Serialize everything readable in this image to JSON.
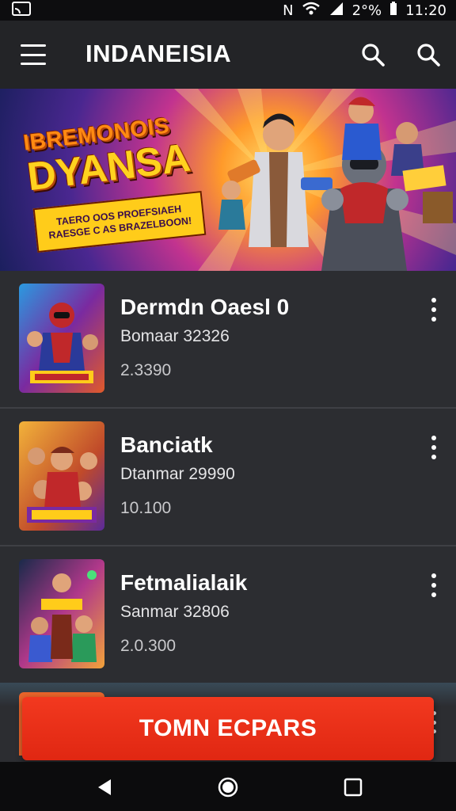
{
  "status_bar": {
    "left_icon": "cast-icon",
    "signal_label": "N",
    "battery_text": "2°%",
    "time": "11:20"
  },
  "app_bar": {
    "title": "INDANEISIA"
  },
  "banner": {
    "title_line1": "IBREMONOIS",
    "title_line2": "DYANSA",
    "ribbon_line1": "TAERO OOS PROEFSIAEH",
    "ribbon_line2": "RAESGE C AS BRAZELBOON!"
  },
  "items": [
    {
      "title": "Dermdn Oaesl 0",
      "subtitle": "Bomaar 32326",
      "meta": "2.3390"
    },
    {
      "title": "Banciatk",
      "subtitle": "Dtanmar 29990",
      "meta": "10.100"
    },
    {
      "title": "Fetmalialaik",
      "subtitle": "Sanmar 32806",
      "meta": "2.0.300"
    }
  ],
  "cta": {
    "label": "TOMN ECPARS"
  },
  "colors": {
    "background": "#2b2c2f",
    "app_bar": "#232427",
    "cta": "#e8301a",
    "nav_bar": "#0c0c0d"
  }
}
